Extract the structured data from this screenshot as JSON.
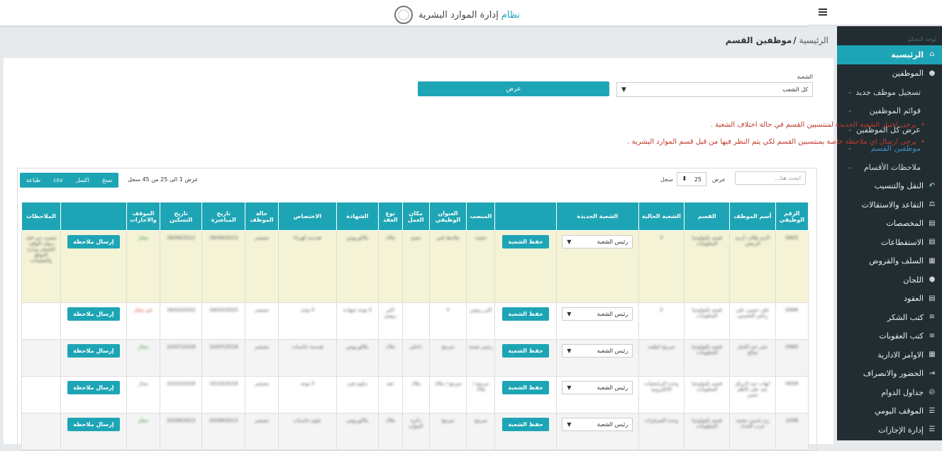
{
  "app": {
    "brand_accent": "نظام",
    "brand_rest": "إدارة الموارد البشرية"
  },
  "breadcrumb": {
    "home": "الرئيسية",
    "sep": "/",
    "current": "موظفين القسم"
  },
  "sidebar": {
    "header": "لوحة التحكم",
    "items": [
      {
        "label": "الرئيسية",
        "icon": "home-icon",
        "glyph": "⌂"
      },
      {
        "label": "الموظفين",
        "icon": "user-icon",
        "glyph": "●"
      },
      {
        "label": "النقل والتنسيب",
        "icon": "reply-icon",
        "glyph": "↶"
      },
      {
        "label": "التقاعد والاستقالات",
        "icon": "balance-icon",
        "glyph": "⚖"
      },
      {
        "label": "المخصصات",
        "icon": "file-icon",
        "glyph": "▤"
      },
      {
        "label": "الاستقطاعات",
        "icon": "file-icon",
        "glyph": "▤"
      },
      {
        "label": "السلف والقروض",
        "icon": "money-icon",
        "glyph": "▦"
      },
      {
        "label": "اللجان",
        "icon": "users-icon",
        "glyph": "●"
      },
      {
        "label": "العقود",
        "icon": "file-icon",
        "glyph": "▤"
      },
      {
        "label": "كتب الشكر",
        "icon": "layers-icon",
        "glyph": "≋"
      },
      {
        "label": "كتب العقوبات",
        "icon": "layers-icon",
        "glyph": "≋"
      },
      {
        "label": "الاوامر الادارية",
        "icon": "table-icon",
        "glyph": "▦"
      },
      {
        "label": "الحضور والانصراف",
        "icon": "login-icon",
        "glyph": "⇥"
      },
      {
        "label": "جداول الدوام",
        "icon": "fingerprint-icon",
        "glyph": "◎"
      },
      {
        "label": "الموقف اليومي",
        "icon": "list-icon",
        "glyph": "☰"
      },
      {
        "label": "إدارة الإجازات",
        "icon": "list-icon",
        "glyph": "☰"
      }
    ],
    "sub_items": [
      "تسجيل موظف جديد",
      "قوائم الموظفين",
      "عرض كل الموظفين",
      "موظفين القسم",
      "ملاحظات الأقسام"
    ]
  },
  "filter": {
    "label": "الشعبة",
    "value": "كل الشعب",
    "button": "عرض"
  },
  "notes": [
    "يرجى اختيار الشعبة الجديدة لمنتسبين القسم في حالة اختلاف الشعبة .",
    "يرجى ارسال اي ملاحظة خاصة بمنتسبين القسم لكي يتم النظر فيها من قبل قسم الموارد البشرية ."
  ],
  "table_tools": {
    "buttons": [
      "نسخ",
      "اكسل",
      "csv",
      "طباعة"
    ],
    "info": "عرض 1 الى 25 من 45 سجل",
    "show_label": "عرض",
    "page_size": "25",
    "records_label": "سجل",
    "search_placeholder": "ابحث هنا..."
  },
  "table": {
    "headers": [
      "الرقم الوظيفي",
      "أسم الموظف",
      "القسم",
      "الشعبة الحالية",
      "الشعبة الجديدة",
      "",
      "المنصب",
      "العنوان الوظيفي",
      "مكان العمل",
      "نوع العقد",
      "الشهادة",
      "الاختصاص",
      "حالة الموظف",
      "تاريخ المباشرة",
      "تاريخ التسكين",
      "الموقف والاجازات",
      "",
      "الملاحظات"
    ],
    "select_value": "رئيس الشعبة",
    "save_label": "حفظ الشعبة",
    "note_label": "إرسال ملاحظة",
    "rows": [
      {
        "id": "0805",
        "name": "اكرم طالب كريم الربيعي",
        "dept": "قسم تكنولوجيا المعلومات",
        "cur": "لا",
        "pos": "شعبة",
        "title": "ملاحظ فني",
        "place": "مقيم",
        "contract": "ملاك",
        "cert": "بكالوريوس",
        "spec": "هندسة كهرباء",
        "status": "مستمر",
        "start": "28/08/2013",
        "house": "28/08/2012",
        "sit": "مجاز",
        "sit_ok": true,
        "remarks": "تنسيب من قبل ديوان الوقف الشيعي وزارة الموقع والتعليمات"
      },
      {
        "id": "0996",
        "name": "علي حسين علي رياض الحسيني",
        "dept": "قسم تكنولوجيا المعلومات",
        "cur": "لا",
        "pos": "اكبر ريوس",
        "title": "لا",
        "place": "",
        "contract": "اكبر ريوس",
        "cert": "لا توجد شهادة",
        "spec": "لا توجد",
        "status": "مستمر",
        "start": "18/03/2020",
        "house": "18/03/2020",
        "sit": "غير مجاز",
        "sit_ok": false,
        "remarks": ""
      },
      {
        "id": "0985",
        "name": "عمر عبد الجبار صالح",
        "dept": "قسم تكنولوجيا المعلومات",
        "cur": "مبرمج انظمة",
        "pos": "رئيس شعبة",
        "title": "مبرمج",
        "place": "داخلي",
        "contract": "ملاك",
        "cert": "بكالوريوس",
        "spec": "هندسة حاسبات",
        "status": "مستمر",
        "start": "10/07/2018",
        "house": "10/07/2018",
        "sit": "مجاز",
        "sit_ok": true,
        "remarks": ""
      },
      {
        "id": "0939",
        "name": "ايهاب عبد الرزاق عبد علي كاظم حسن",
        "dept": "قسم تكنولوجيا المعلومات",
        "cur": "وحدة البرامجيات الالكترونية",
        "pos": "مبرمج / ملاك",
        "title": "مبرمج / ملاك",
        "place": "ملاك",
        "contract": "عقد",
        "cert": "دبلوم فني",
        "spec": "لا توجد",
        "status": "مستمر",
        "start": "10/10/2018",
        "house": "10/10/2018",
        "sit": "مجاز",
        "sit_ok": true,
        "remarks": ""
      },
      {
        "id": "1046",
        "name": "زيد ياسين محمد جرب الحداد",
        "dept": "قسم تكنولوجيا المعلومات",
        "cur": "وحدة السرفرات",
        "pos": "مبرمج",
        "title": "مبرمج",
        "place": "دائرة الموارد",
        "contract": "ملاك",
        "cert": "بكالوريوس",
        "spec": "علوم حاسبات",
        "status": "مستمر",
        "start": "20/08/2013",
        "house": "20/08/2013",
        "sit": "مجاز",
        "sit_ok": true,
        "remarks": ""
      }
    ]
  },
  "colors": {
    "accent": "#1ea5b5",
    "sidebar": "#222d32",
    "highlight_row": "#f5f3d6"
  }
}
